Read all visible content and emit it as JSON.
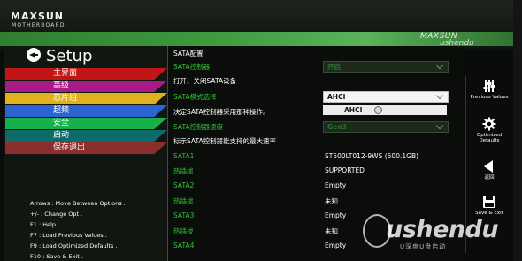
{
  "header": {
    "logo": "MAXSUN",
    "logo_sub": "MOTHERBOARD",
    "brand_right": "MAXSUN",
    "brand_right_sub": "ushendu"
  },
  "sidebar": {
    "title": "Setup",
    "items": [
      {
        "label": "主界面",
        "color": "#c21616"
      },
      {
        "label": "高级",
        "color": "#a91a86"
      },
      {
        "label": "芯片组",
        "color": "#e0b21e"
      },
      {
        "label": "超频",
        "color": "#2c63d2"
      },
      {
        "label": "安全",
        "color": "#18b04a"
      },
      {
        "label": "启动",
        "color": "#0f6a6a"
      },
      {
        "label": "保存退出",
        "color": "#8a2e2e"
      }
    ],
    "help": [
      "Arrows : Move Between Options .",
      "+/- : Change Opt .",
      "F1 : Help",
      "F7 : Load Previous Values .",
      "F9 : Load Optimized Defaults .",
      "F10 : Save & Exit ."
    ]
  },
  "main": {
    "section": "SATA配置",
    "rows": [
      {
        "label": "SATA控制器",
        "kind": "green",
        "value": "开启"
      },
      {
        "label": "打开、关闭SATA设备",
        "kind": "white"
      },
      {
        "label": "SATA模式选择",
        "kind": "green",
        "value": "AHCI"
      },
      {
        "label": "决定SATA控制器采用那种操作。",
        "kind": "white"
      },
      {
        "label": "SATA控制器速度",
        "kind": "green",
        "value": "Gen3"
      },
      {
        "label": "标示SATA控制器能支持的最大速率",
        "kind": "white"
      },
      {
        "label": "SATA1",
        "kind": "green",
        "value": "ST500LT012-9WS (500.1GB)"
      },
      {
        "label": "热插拔",
        "kind": "green",
        "value": "SUPPORTED"
      },
      {
        "label": "SATA2",
        "kind": "green",
        "value": "Empty"
      },
      {
        "label": "热插拔",
        "kind": "green",
        "value": "未知"
      },
      {
        "label": "SATA3",
        "kind": "green",
        "value": "Empty"
      },
      {
        "label": "热插拔",
        "kind": "green",
        "value": "未知"
      },
      {
        "label": "SATA4",
        "kind": "green",
        "value": "Empty"
      }
    ],
    "dropdown_option": "AHCI"
  },
  "right": {
    "buttons": [
      {
        "label": "Previous Values",
        "icon": "sliders-icon"
      },
      {
        "label": "Optimized Defaults",
        "icon": "gear-icon"
      },
      {
        "label": "返回",
        "icon": "back-arrow-icon"
      },
      {
        "label": "Save & Exit",
        "icon": "save-icon"
      }
    ]
  },
  "watermark": {
    "text": "ushendu",
    "sub": "U深度U盘启动"
  },
  "colors": {
    "accent": "#35c235",
    "band": "#3d9a3d"
  }
}
